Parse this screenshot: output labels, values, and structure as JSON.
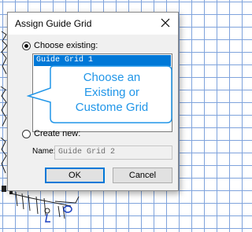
{
  "dialog": {
    "title": "Assign Guide Grid",
    "choose_existing_label": "Choose existing:",
    "choose_existing_selected": true,
    "list_items": [
      "Guide Grid 1"
    ],
    "create_new_label": "Create new:",
    "create_new_selected": false,
    "name_label": "Name:",
    "name_placeholder": "Guide Grid 2",
    "ok_label": "OK",
    "cancel_label": "Cancel"
  },
  "callout": {
    "line1": "Choose an",
    "line2": "Existing or",
    "line3": "Custome Grid"
  },
  "colors": {
    "grid_lines": "#7fa3dc",
    "selection": "#0078d7",
    "callout_text": "#2196e8"
  },
  "icons": [
    "close-icon"
  ]
}
